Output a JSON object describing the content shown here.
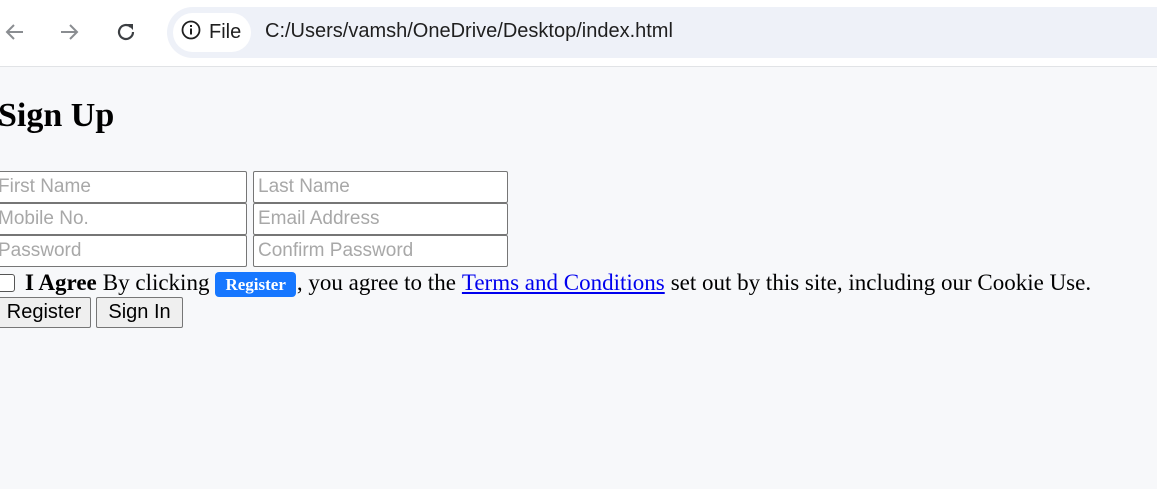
{
  "browser": {
    "chip_label": "File",
    "url": "C:/Users/vamsh/OneDrive/Desktop/index.html",
    "icons": {
      "back": "back-arrow-icon",
      "forward": "forward-arrow-icon",
      "reload": "reload-icon",
      "info": "info-icon"
    }
  },
  "form": {
    "title": "Sign Up",
    "fields": {
      "first_name": {
        "placeholder": "First Name",
        "value": ""
      },
      "last_name": {
        "placeholder": "Last Name",
        "value": ""
      },
      "mobile": {
        "placeholder": "Mobile No.",
        "value": ""
      },
      "email": {
        "placeholder": "Email Address",
        "value": ""
      },
      "password": {
        "placeholder": "Password",
        "value": ""
      },
      "confirm_password": {
        "placeholder": "Confirm Password",
        "value": ""
      }
    },
    "agree": {
      "checked": false,
      "bold_label": "I Agree",
      "text_before": "By clicking",
      "badge": "Register",
      "text_middle": ", you agree to the",
      "link": "Terms and Conditions",
      "text_after": "set out by this site, including our Cookie Use."
    },
    "buttons": {
      "register": "Register",
      "sign_in": "Sign In"
    }
  },
  "colors": {
    "badge_bg": "#1677ff",
    "link": "#0000ee",
    "page_bg": "#f7f8fa",
    "omnibox_bg": "#eef1f8"
  }
}
